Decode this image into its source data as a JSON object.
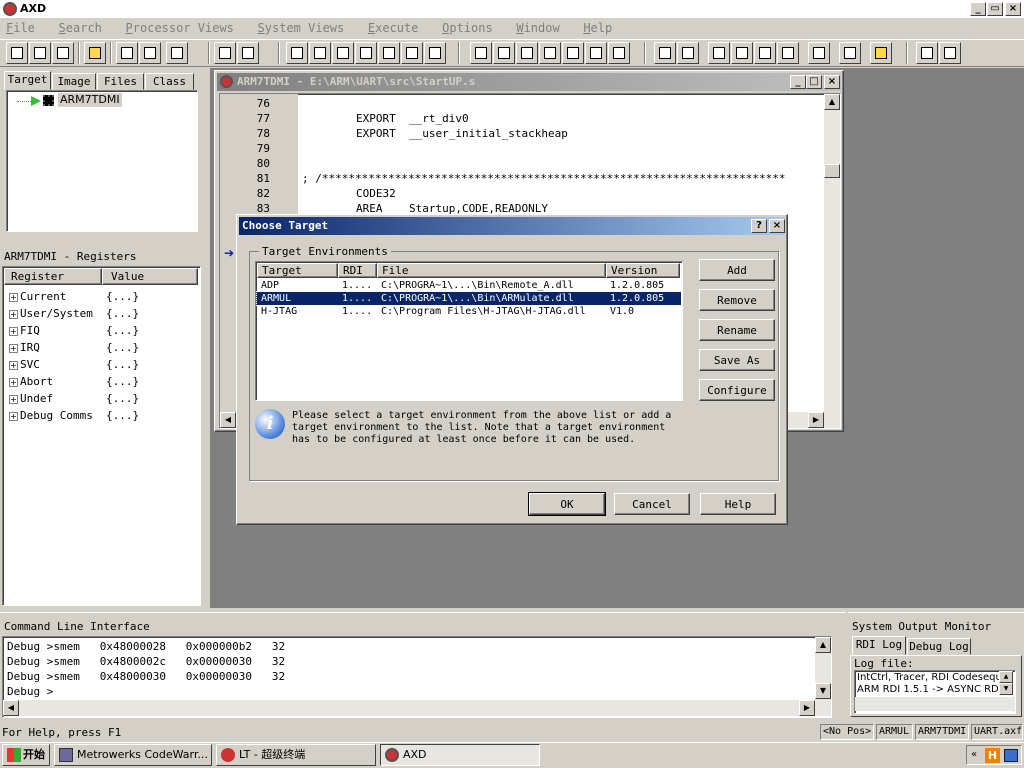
{
  "app": {
    "title": "AXD"
  },
  "menu": [
    "File",
    "Search",
    "Processor Views",
    "System Views",
    "Execute",
    "Options",
    "Window",
    "Help"
  ],
  "left_tabs": [
    "Target",
    "Image",
    "Files",
    "Class"
  ],
  "tree": {
    "root": "ARM7TDMI"
  },
  "registers": {
    "title": "ARM7TDMI - Registers",
    "col_register": "Register",
    "col_value": "Value",
    "rows": [
      {
        "name": "Current",
        "value": "{...}"
      },
      {
        "name": "User/System",
        "value": "{...}"
      },
      {
        "name": "FIQ",
        "value": "{...}"
      },
      {
        "name": "IRQ",
        "value": "{...}"
      },
      {
        "name": "SVC",
        "value": "{...}"
      },
      {
        "name": "Abort",
        "value": "{...}"
      },
      {
        "name": "Undef",
        "value": "{...}"
      },
      {
        "name": "Debug Comms",
        "value": "{...}"
      }
    ]
  },
  "code_window": {
    "title": "ARM7TDMI - E:\\ARM\\UART\\src\\StartUP.s",
    "lines": [
      {
        "n": "76",
        "t": ""
      },
      {
        "n": "77",
        "t": "        EXPORT  __rt_div0"
      },
      {
        "n": "78",
        "t": "        EXPORT  __user_initial_stackheap"
      },
      {
        "n": "79",
        "t": ""
      },
      {
        "n": "80",
        "t": ""
      },
      {
        "n": "81",
        "t": "; /**********************************************************************"
      },
      {
        "n": "82",
        "t": "        CODE32"
      },
      {
        "n": "83",
        "t": "        AREA    Startup,CODE,READONLY"
      }
    ]
  },
  "dialog": {
    "title": "Choose Target",
    "group_label": "Target Environments",
    "columns": [
      "Target",
      "RDI",
      "File",
      "Version"
    ],
    "rows": [
      {
        "target": "ADP",
        "rdi": "1....",
        "file": "C:\\PROGRA~1\\...\\Bin\\Remote_A.dll",
        "version": "1.2.0.805"
      },
      {
        "target": "ARMUL",
        "rdi": "1....",
        "file": "C:\\PROGRA~1\\...\\Bin\\ARMulate.dll",
        "version": "1.2.0.805"
      },
      {
        "target": "H-JTAG",
        "rdi": "1....",
        "file": "C:\\Program Files\\H-JTAG\\H-JTAG.dll",
        "version": "V1.0"
      }
    ],
    "side_buttons": [
      "Add",
      "Remove",
      "Rename",
      "Save As",
      "Configure"
    ],
    "info_text": "Please select a target environment from the above list or add a target environment to the list. Note that a target environment has to be configured at least once before it can be used.",
    "ok": "OK",
    "cancel": "Cancel",
    "help": "Help"
  },
  "cli": {
    "title": "Command Line Interface",
    "rows": [
      "Debug >smem   0x48000028   0x000000b2   32",
      "Debug >smem   0x4800002c   0x00000030   32",
      "Debug >smem   0x48000030   0x00000030   32",
      "Debug >"
    ]
  },
  "som": {
    "title": "System Output Monitor",
    "tabs": [
      "RDI Log",
      "Debug Log"
    ],
    "log_label": "Log file:",
    "log_lines": [
      "IntCtrl, Tracer, RDI Codesequ",
      "ARM RDI 1.5.1 -> ASYNC RD"
    ]
  },
  "status": {
    "help": "For Help, press F1",
    "pos": "<No Pos>",
    "target": "ARMUL",
    "proc": "ARM7TDMI",
    "image": "UART.axf"
  },
  "taskbar": {
    "start": "开始",
    "tasks": [
      "Metrowerks CodeWarr...",
      "LT - 超级终端",
      "AXD"
    ]
  }
}
